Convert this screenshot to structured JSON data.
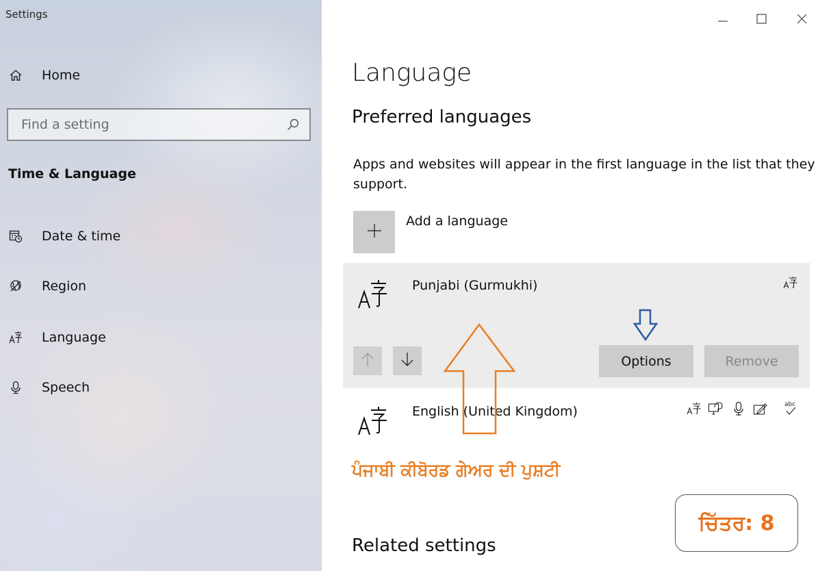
{
  "window": {
    "title": "Settings",
    "controls": [
      "minimize-icon",
      "maximize-icon",
      "close-icon"
    ]
  },
  "sidebar": {
    "home_label": "Home",
    "search_placeholder": "Find a setting",
    "section_title": "Time & Language",
    "items": [
      {
        "label": "Date & time",
        "icon": "calendar-clock-icon"
      },
      {
        "label": "Region",
        "icon": "globe-icon"
      },
      {
        "label": "Language",
        "icon": "language-icon"
      },
      {
        "label": "Speech",
        "icon": "microphone-icon"
      }
    ]
  },
  "main": {
    "title": "Language",
    "subtitle": "Preferred languages",
    "description": "Apps and websites will appear in the first language in the list that they support.",
    "add_language_label": "Add a language",
    "languages": [
      {
        "name": "Punjabi (Gurmukhi)",
        "selected": true,
        "features": [
          "display-language-icon"
        ]
      },
      {
        "name": "English (United Kingdom)",
        "selected": false,
        "features": [
          "display-language-icon",
          "text-to-speech-icon",
          "speech-icon",
          "handwriting-icon",
          "spelling-icon"
        ]
      }
    ],
    "buttons": {
      "options": "Options",
      "remove": "Remove"
    },
    "related_title": "Related settings"
  },
  "annotations": {
    "gurmukhi_note": "ਪੰਜਾਬੀ ਕੀਬੋਰਡ ਗੇਅਰ ਦੀ ਪੁਸ਼ਟੀ",
    "figure_label": "ਚਿੱਤਰ: 8",
    "arrow_color_large": "#e87f24",
    "arrow_color_small": "#2f5aa0"
  }
}
